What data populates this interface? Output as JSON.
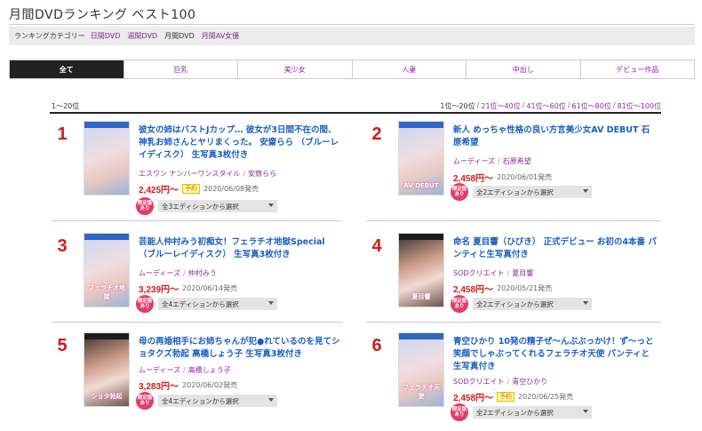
{
  "page": {
    "title": "月間DVDランキング ベスト100"
  },
  "categories": {
    "label": "ランキングカテゴリー",
    "links": [
      {
        "label": "日間DVD",
        "active": false
      },
      {
        "label": "週間DVD",
        "active": false
      },
      {
        "label": "月間DVD",
        "active": true
      },
      {
        "label": "月間AV女優",
        "active": false
      }
    ]
  },
  "tabs": [
    {
      "label": "全て",
      "active": true
    },
    {
      "label": "巨乳",
      "active": false
    },
    {
      "label": "美少女",
      "active": false
    },
    {
      "label": "人妻",
      "active": false
    },
    {
      "label": "中出し",
      "active": false
    },
    {
      "label": "デビュー作品",
      "active": false
    }
  ],
  "range": {
    "label": "1〜20位",
    "pages": [
      "1位〜20位",
      "21位〜40位",
      "41位〜60位",
      "61位〜80位",
      "81位〜100位"
    ]
  },
  "items": [
    {
      "rank": "1",
      "title": "彼女の姉はバストJカップ… 彼女が3日間不在の間、神乳お姉さんとヤリまくった。 安齋らら （ブルーレイディスク） 生写真3枚付き",
      "maker": "エスワン ナンバーワンスタイル",
      "actress": "安齋らら",
      "price": "2,425円〜",
      "reserve": "予約",
      "date": "2020/06/08発売",
      "limited": "限定版あり",
      "edition": "全3エディションから選択",
      "cover_text": ""
    },
    {
      "rank": "2",
      "title": "新人 めっちゃ性格の良い方言美少女AV DEBUT 石原希望",
      "maker": "ムーディーズ",
      "actress": "石原希望",
      "price": "2,458円〜",
      "reserve": "",
      "date": "2020/06/01発売",
      "limited": "限定版あり",
      "edition": "全2エディションから選択",
      "cover_text": "AV DEBUT"
    },
    {
      "rank": "3",
      "title": "芸能人仲村みう初痴女！フェラチオ地獄Special （ブルーレイディスク） 生写真3枚付き",
      "maker": "ムーディーズ",
      "actress": "仲村みう",
      "price": "3,239円〜",
      "reserve": "",
      "date": "2020/06/14発売",
      "limited": "限定版あり",
      "edition": "全4エディションから選択",
      "cover_text": "フェラチオ地獄"
    },
    {
      "rank": "4",
      "title": "命名 夏目響（ひびき） 正式デビュー お初の4本番 パンティと生写真付き",
      "maker": "SODクリエイト",
      "actress": "夏目響",
      "price": "2,458円〜",
      "reserve": "",
      "date": "2020/05/21発売",
      "limited": "限定版あり",
      "edition": "全2エディションから選択",
      "cover_text": "夏目響"
    },
    {
      "rank": "5",
      "title": "母の再婚相手にお姉ちゃんが犯●れているのを見てショタクズ勃起 高橋しょう子 生写真3枚付き",
      "maker": "ムーディーズ",
      "actress": "高橋しょう子",
      "price": "3,283円〜",
      "reserve": "",
      "date": "2020/06/02発売",
      "limited": "限定版あり",
      "edition": "全4エディションから選択",
      "cover_text": "ショタ勃起"
    },
    {
      "rank": "6",
      "title": "青空ひかり 10発の精子ぜ〜んぶぶっかけ！ず〜っと笑顔でしゃぶってくれるフェラチオ天使 パンティと生写真付き",
      "maker": "SODクリエイト",
      "actress": "青空ひかり",
      "price": "2,458円〜",
      "reserve": "予約",
      "date": "2020/06/25発売",
      "limited": "限定版あり",
      "edition": "全2エディションから選択",
      "cover_text": "フェラチオ天使"
    }
  ]
}
